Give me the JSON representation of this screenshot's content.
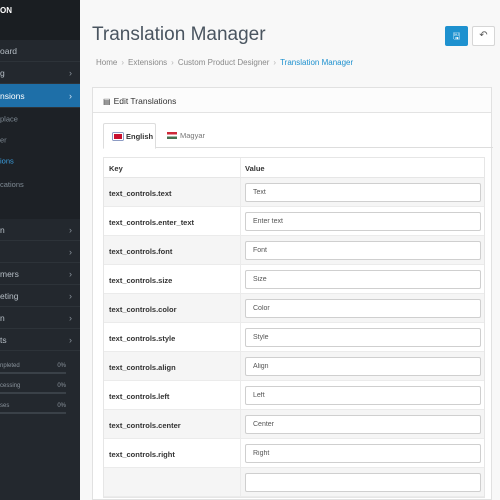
{
  "sidebar": {
    "brand": "ON",
    "items": [
      {
        "label": "oard",
        "chevron": false,
        "active": false
      },
      {
        "label": "g",
        "chevron": true,
        "active": false
      },
      {
        "label": "nsions",
        "chevron": true,
        "active": true
      }
    ],
    "subitems": [
      {
        "label": "place",
        "active": false
      },
      {
        "label": "er",
        "active": false
      },
      {
        "label": "ions",
        "active": true
      },
      {
        "label": "cations",
        "active": false
      }
    ],
    "items2": [
      {
        "label": "n",
        "chevron": true
      },
      {
        "label": "",
        "chevron": true
      },
      {
        "label": "mers",
        "chevron": true
      },
      {
        "label": "eting",
        "chevron": true
      },
      {
        "label": "n",
        "chevron": true
      },
      {
        "label": "ts",
        "chevron": true
      }
    ],
    "stats": [
      {
        "label": "npleted",
        "value": "0%",
        "progress": 0
      },
      {
        "label": "cessing",
        "value": "0%",
        "progress": 0
      },
      {
        "label": "ses",
        "value": "0%",
        "progress": 0
      }
    ]
  },
  "header": {
    "title": "Translation Manager",
    "save_icon": "save-icon",
    "back_icon": "reply-icon",
    "save_glyph": "🖫",
    "back_glyph": "↶"
  },
  "breadcrumb": [
    "Home",
    "Extensions",
    "Custom Product Designer",
    "Translation Manager"
  ],
  "breadcrumb_sep": "›",
  "panel": {
    "heading": "Edit Translations",
    "heading_icon": "▤",
    "tabs": [
      {
        "label": "English",
        "flag": "en",
        "active": true
      },
      {
        "label": "Magyar",
        "flag": "hu",
        "active": false
      }
    ],
    "columns": {
      "key": "Key",
      "value": "Value"
    },
    "rows": [
      {
        "key": "text_controls.text",
        "value": "Text"
      },
      {
        "key": "text_controls.enter_text",
        "value": "Enter text"
      },
      {
        "key": "text_controls.font",
        "value": "Font"
      },
      {
        "key": "text_controls.size",
        "value": "Size"
      },
      {
        "key": "text_controls.color",
        "value": "Color"
      },
      {
        "key": "text_controls.style",
        "value": "Style"
      },
      {
        "key": "text_controls.align",
        "value": "Align"
      },
      {
        "key": "text_controls.left",
        "value": "Left"
      },
      {
        "key": "text_controls.center",
        "value": "Center"
      },
      {
        "key": "text_controls.right",
        "value": "Right"
      },
      {
        "key": "",
        "value": ""
      }
    ]
  },
  "colors": {
    "sidebar_bg": "#23282e",
    "accent": "#1e91cf",
    "active_nav": "#1e6fa8"
  }
}
